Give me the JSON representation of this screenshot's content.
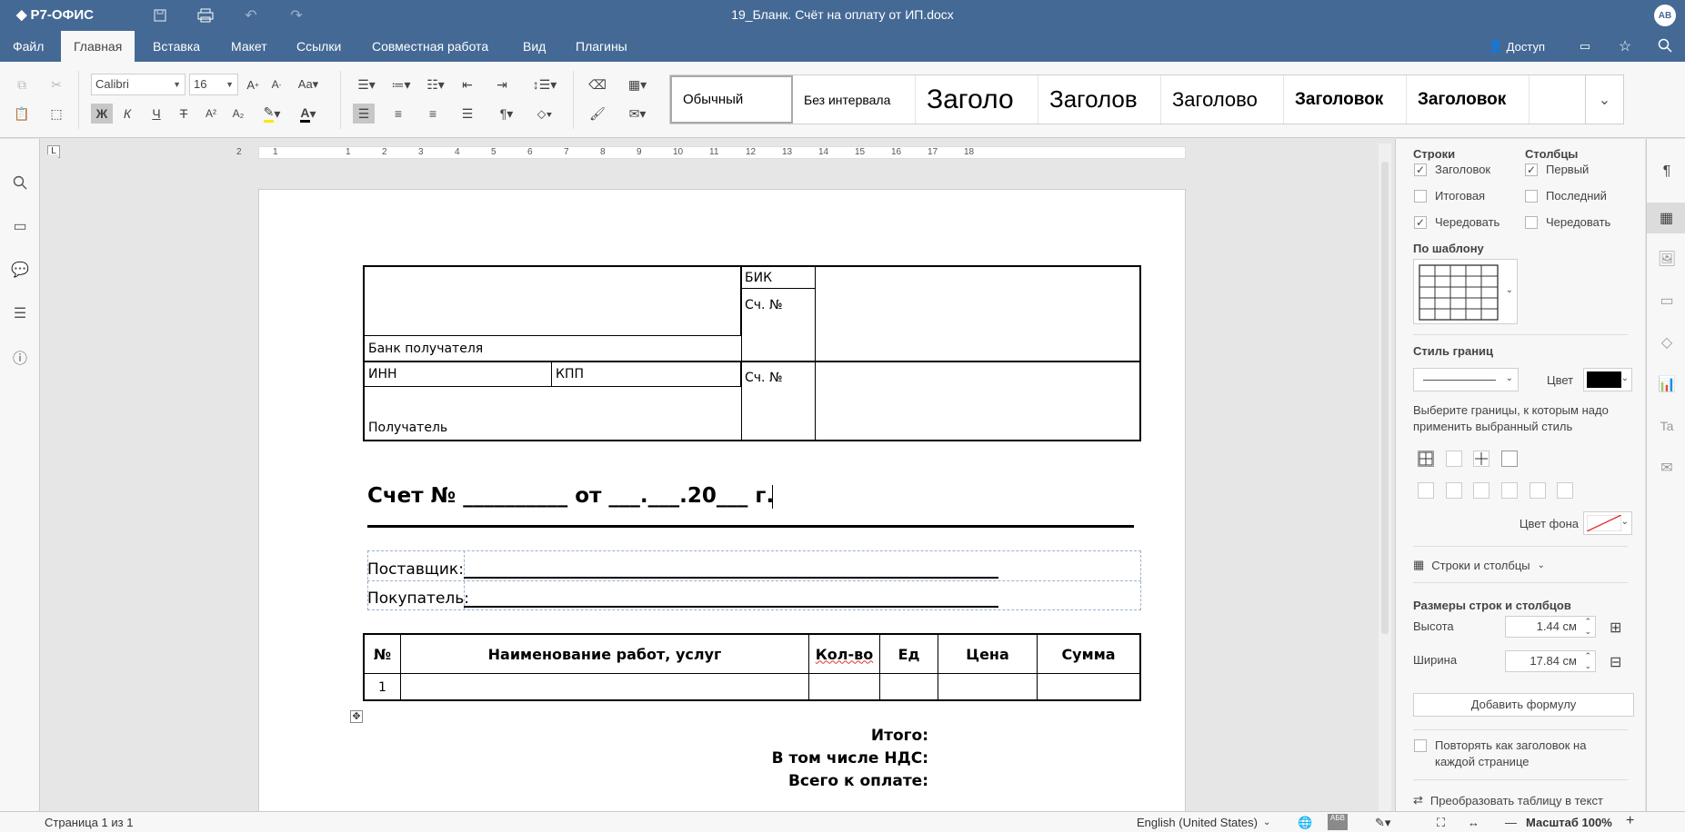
{
  "app": {
    "brand": "Р7-ОФИС",
    "doc_title": "19_Бланк. Счёт на оплату от ИП.docx",
    "user_initials": "AB"
  },
  "menu": {
    "tabs": [
      "Файл",
      "Главная",
      "Вставка",
      "Макет",
      "Ссылки",
      "Совместная работа",
      "Вид",
      "Плагины"
    ],
    "active": "Главная",
    "access_label": "Доступ"
  },
  "toolbar": {
    "font_name": "Calibri",
    "font_size": "16",
    "bold": "Ж",
    "italic": "К",
    "underline": "Ч",
    "strike": "Т",
    "styles": [
      "Обычный",
      "Без интервала",
      "Заголо",
      "Заголов",
      "Заголово",
      "Заголовок",
      "Заголовок"
    ]
  },
  "document": {
    "bank": {
      "bik": "БИК",
      "acc1": "Сч. №",
      "bank_label": "Банк получателя",
      "inn": "ИНН",
      "kpp": "КПП",
      "acc2": "Сч. №",
      "recipient": "Получатель"
    },
    "invoice_title": "Счет № __________ от ___.___.20___ г.",
    "supplier_label": "Поставщик:",
    "buyer_label": "Покупатель:",
    "table": {
      "headers": [
        "№",
        "Наименование работ, услуг",
        "Кол-во",
        "Ед",
        "Цена",
        "Сумма"
      ],
      "rows": [
        [
          "1",
          "",
          "",
          "",
          "",
          ""
        ]
      ]
    },
    "totals": {
      "itogo": "Итого:",
      "nds": "В том числе НДС:",
      "total": "Всего к оплате:"
    }
  },
  "panel": {
    "rows_header": "Строки",
    "cols_header": "Столбцы",
    "row_options": [
      {
        "label": "Заголовок",
        "checked": true
      },
      {
        "label": "Итоговая",
        "checked": false
      },
      {
        "label": "Чередовать",
        "checked": true
      }
    ],
    "col_options": [
      {
        "label": "Первый",
        "checked": true
      },
      {
        "label": "Последний",
        "checked": false
      },
      {
        "label": "Чередовать",
        "checked": false
      }
    ],
    "template_label": "По шаблону",
    "border_style_label": "Стиль границ",
    "color_label": "Цвет",
    "border_hint": "Выберите границы, к которым надо применить выбранный стиль",
    "bg_color_label": "Цвет фона",
    "rows_cols_label": "Строки и столбцы",
    "sizes_header": "Размеры строк и столбцов",
    "height_label": "Высота",
    "height_value": "1.44 см",
    "width_label": "Ширина",
    "width_value": "17.84 см",
    "add_formula": "Добавить формулу",
    "repeat_header": "Повторять как заголовок на каждой странице",
    "convert_label": "Преобразовать таблицу в текст"
  },
  "status": {
    "page": "Страница 1 из 1",
    "language": "English (United States)",
    "zoom": "Масштаб 100%"
  },
  "colors": {
    "header": "#446995",
    "accent_red": "#e03030"
  }
}
